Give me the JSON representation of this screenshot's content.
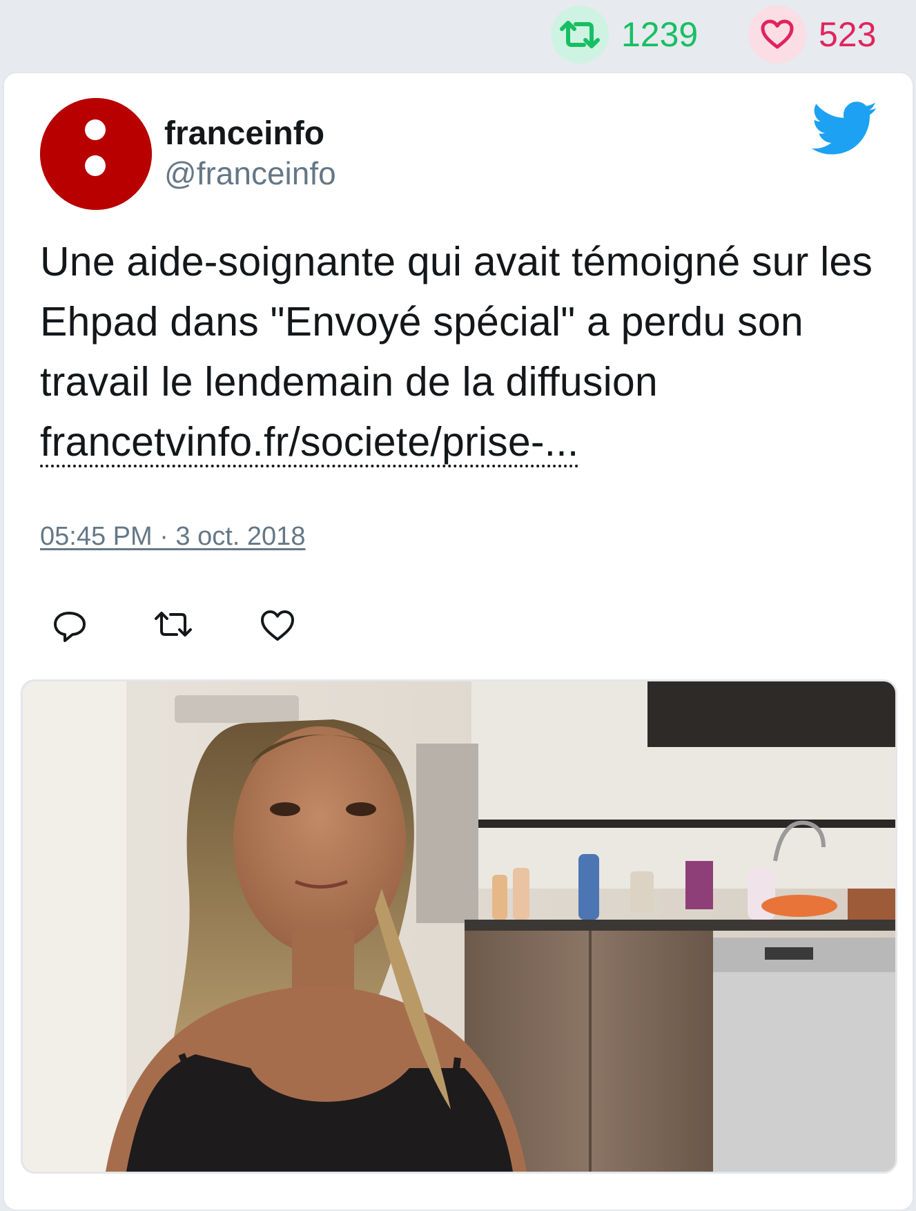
{
  "stats": {
    "retweet_count": "1239",
    "like_count": "523",
    "retweet_color": "#17bf63",
    "like_color": "#e0245e",
    "retweet_icon": "retweet-icon",
    "like_icon": "heart-icon"
  },
  "tweet": {
    "author_name": "franceinfo",
    "author_handle": "@franceinfo",
    "avatar_color": "#b80000",
    "text": "Une aide-soignante qui avait témoigné sur les Ehpad dans \"Envoyé spécial\" a perdu son travail le lendemain de la diffusion ",
    "link_text": "francetvinfo.fr/societe/prise-...",
    "timestamp": "05:45 PM · 3 oct. 2018",
    "brand_icon": "twitter-bird-icon"
  },
  "actions": [
    "reply-icon",
    "retweet-icon",
    "heart-icon"
  ],
  "media": {
    "type": "photo",
    "icon": "photo-image"
  }
}
